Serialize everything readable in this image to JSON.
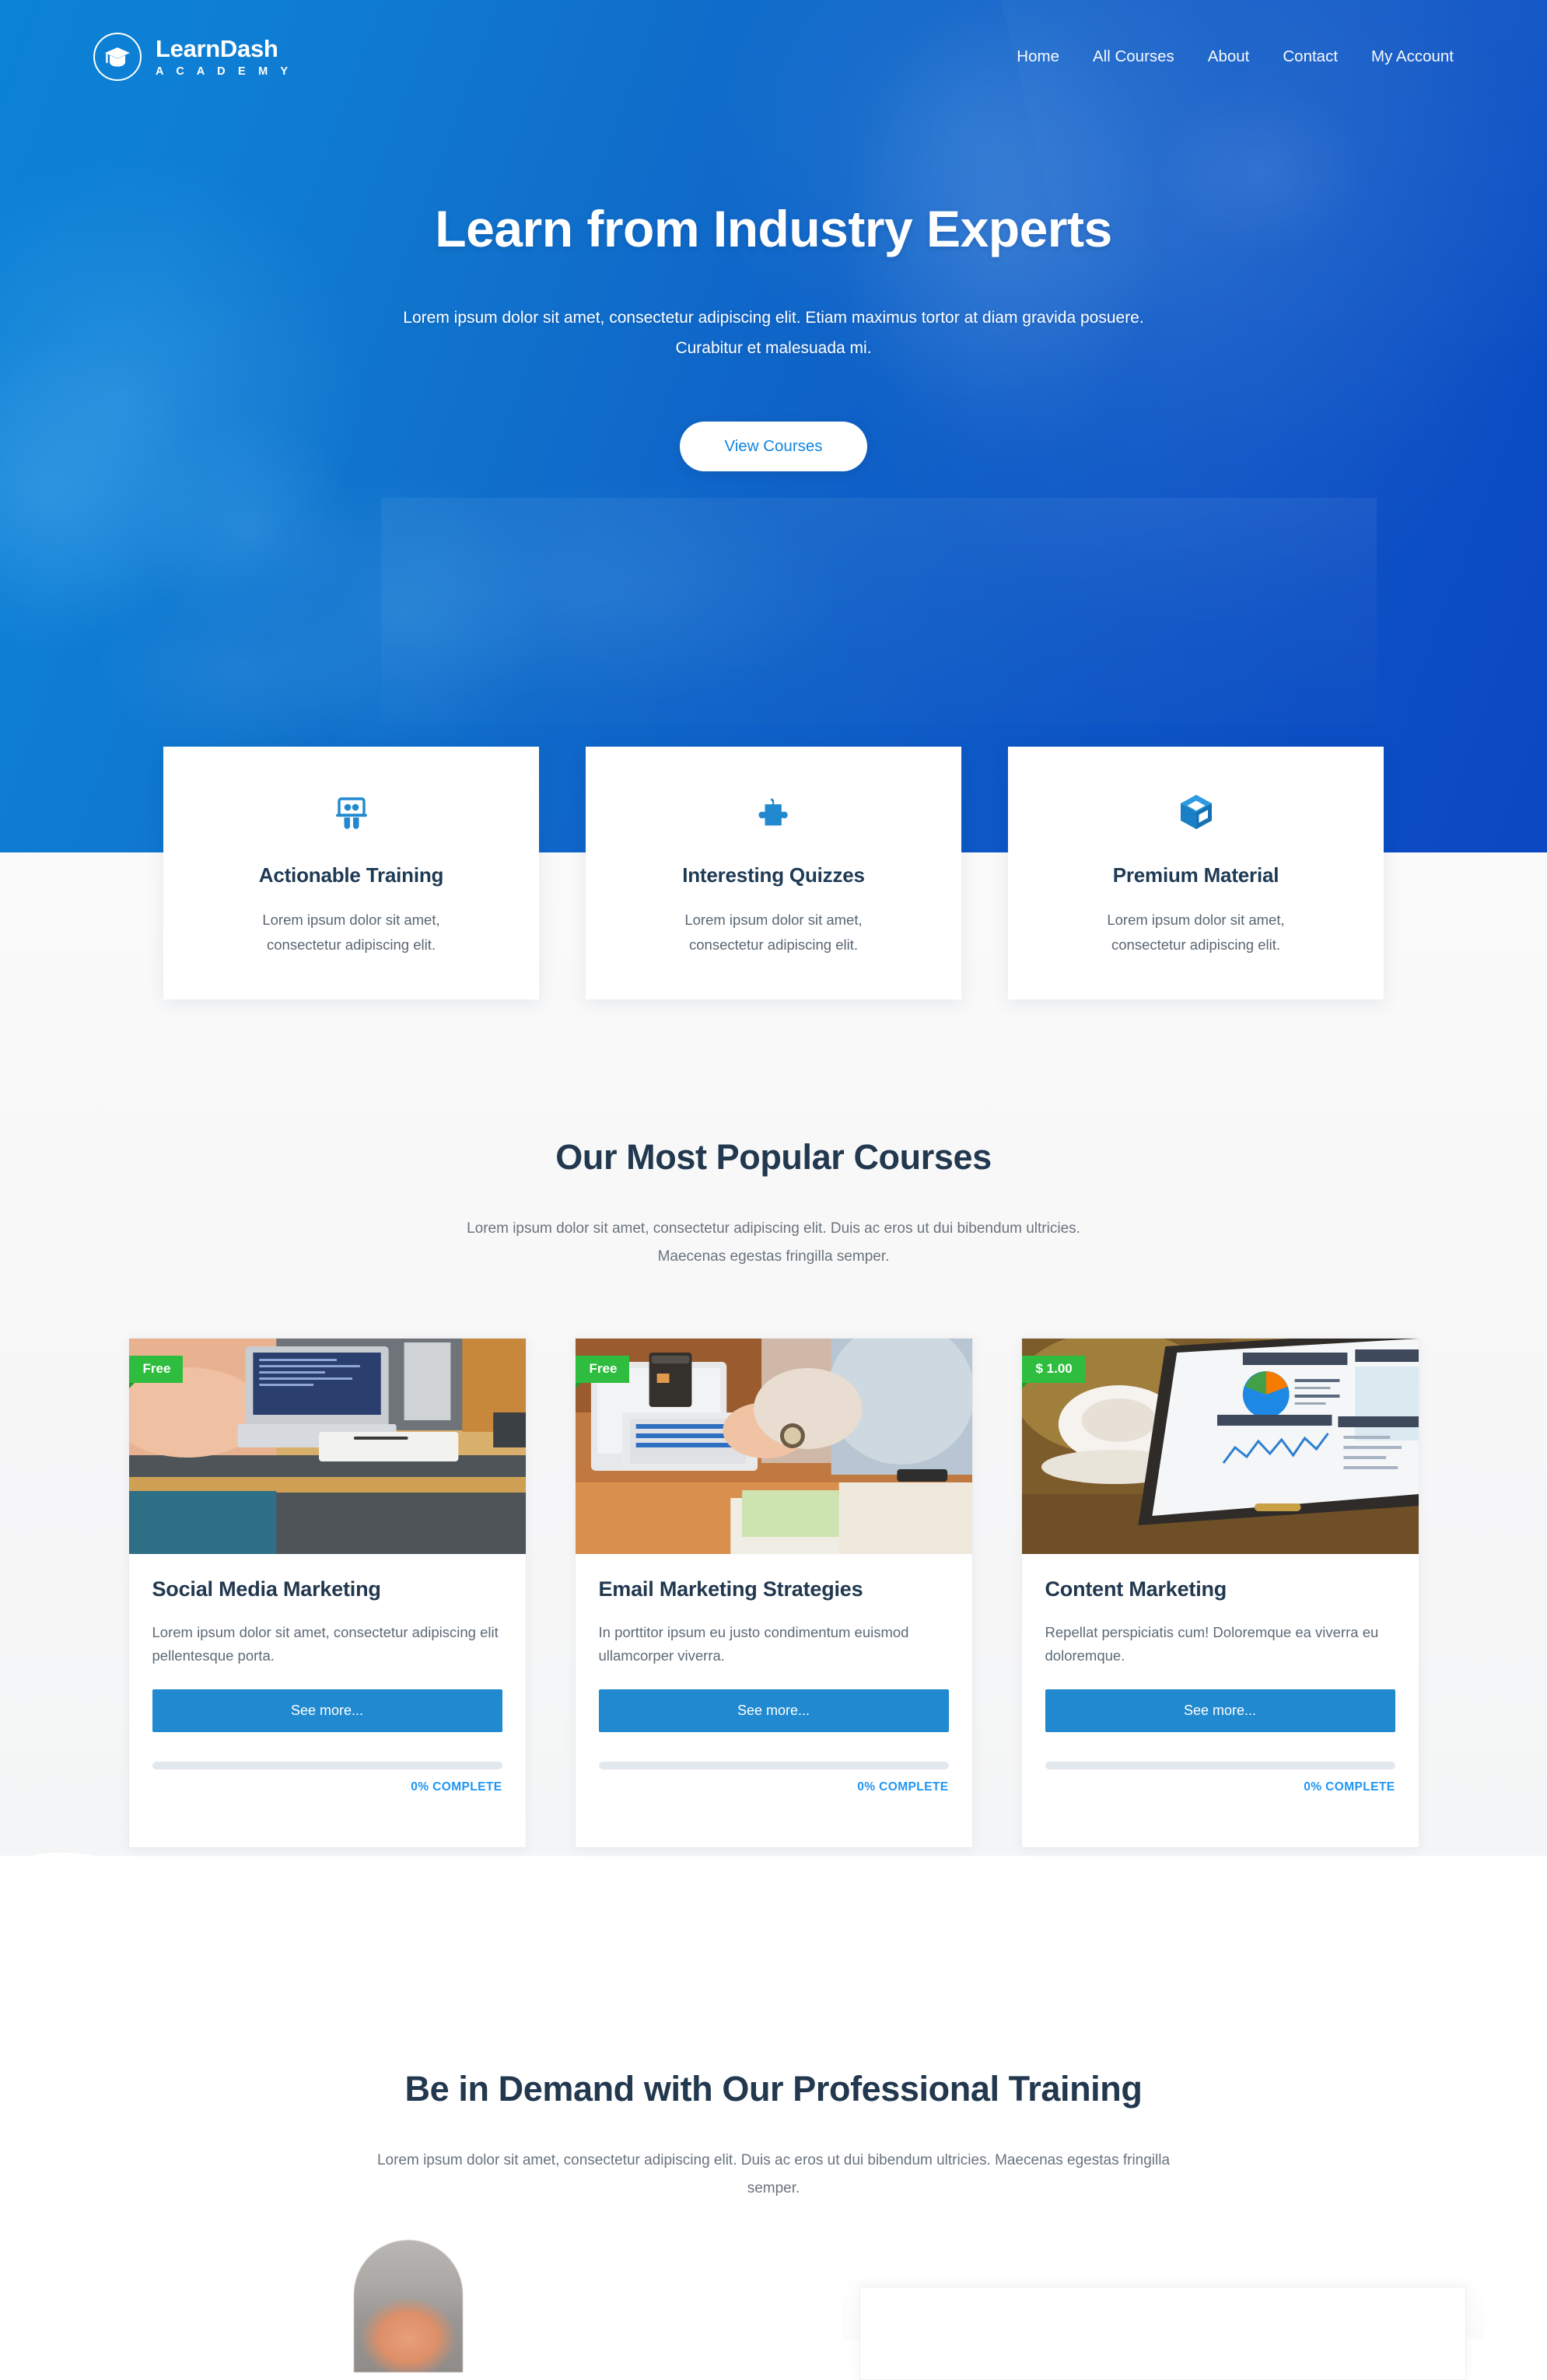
{
  "brand": {
    "name": "LearnDash",
    "subtitle": "A C A D E M Y",
    "logo_icon": "graduation-cap-icon"
  },
  "nav": {
    "items": [
      {
        "label": "Home"
      },
      {
        "label": "All Courses"
      },
      {
        "label": "About"
      },
      {
        "label": "Contact"
      },
      {
        "label": "My Account"
      }
    ]
  },
  "hero": {
    "title": "Learn from Industry Experts",
    "subtitle_line1": "Lorem ipsum dolor sit amet, consectetur adipiscing elit. Etiam maximus tortor at diam gravida posuere.",
    "subtitle_line2": "Curabitur et malesuada mi.",
    "cta_label": "View Courses",
    "gradient_start": "#0b82d6",
    "gradient_end": "#0b48c2"
  },
  "features": [
    {
      "icon": "training-presentation-icon",
      "title": "Actionable Training",
      "desc_line1": "Lorem ipsum dolor sit amet,",
      "desc_line2": "consectetur adipiscing elit."
    },
    {
      "icon": "puzzle-piece-icon",
      "title": "Interesting Quizzes",
      "desc_line1": "Lorem ipsum dolor sit amet,",
      "desc_line2": "consectetur adipiscing elit."
    },
    {
      "icon": "cube-box-icon",
      "title": "Premium Material",
      "desc_line1": "Lorem ipsum dolor sit amet,",
      "desc_line2": "consectetur adipiscing elit."
    }
  ],
  "courses_section": {
    "title": "Our Most Popular Courses",
    "subtitle": "Lorem ipsum dolor sit amet, consectetur adipiscing elit. Duis ac eros ut dui bibendum ultricies. Maecenas egestas fringilla semper.",
    "accent_color": "#2089cf",
    "badge_free_color": "#2fbd3f",
    "progress_color": "#2196f3",
    "items": [
      {
        "badge": "Free",
        "title": "Social Media Marketing",
        "desc": "Lorem ipsum dolor sit amet, consectetur adipiscing elit pellentesque porta.",
        "cta_label": "See more...",
        "progress_label": "0% COMPLETE",
        "progress_percent": 0,
        "thumb_alt": "hands-at-laptop-on-desk-photo"
      },
      {
        "badge": "Free",
        "title": "Email Marketing Strategies",
        "desc": "In porttitor ipsum eu justo condimentum euismod ullamcorper viverra.",
        "cta_label": "See more...",
        "progress_label": "0% COMPLETE",
        "progress_percent": 0,
        "thumb_alt": "person-typing-on-laptop-with-coffee-photo"
      },
      {
        "badge": "$ 1.00",
        "title": "Content Marketing",
        "desc": "Repellat perspiciatis cum! Doloremque ea viverra eu doloremque.",
        "cta_label": "See more...",
        "progress_label": "0% COMPLETE",
        "progress_percent": 0,
        "thumb_alt": "tablet-showing-analytics-dashboard-photo"
      }
    ]
  },
  "training_section": {
    "title": "Be in Demand with Our Professional Training",
    "subtitle": "Lorem ipsum dolor sit amet, consectetur adipiscing elit. Duis ac eros ut dui bibendum ultricies. Maecenas egestas fringilla semper."
  }
}
